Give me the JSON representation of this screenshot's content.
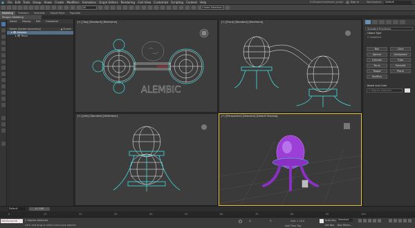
{
  "menus": [
    "File",
    "Edit",
    "Tools",
    "Group",
    "Views",
    "Create",
    "Modifiers",
    "Animation",
    "Graph Editors",
    "Rendering",
    "Civil View",
    "Customize",
    "Scripting",
    "Content",
    "Help"
  ],
  "title_right": {
    "file": "D:\\Stephens\\alembic_project_alembic.max",
    "signin": "Sign In",
    "workspace": "Default"
  },
  "toolbar": {
    "filter_value": "All",
    "selection_set": "Create Selection Se"
  },
  "ribbon_tabs": [
    "Modeling",
    "Freeform",
    "Selection",
    "Object Paint",
    "Populate"
  ],
  "ribbon_active": "Polygon Modeling",
  "explorer": {
    "tabs": [
      "Select",
      "Display",
      "Edit",
      "Customize"
    ],
    "column_header": "Name (Sorted Ascending)",
    "column_right": "▲ Frozen",
    "rows": [
      "Alembic",
      "Tesus"
    ]
  },
  "viewports": {
    "top": "[+] [Top] [Standard] [Wireframe]",
    "front": "[+] [Front] [Standard] [Wireframe]",
    "left": "[+] [Left] [Standard] [Wireframe]",
    "perspective": "[+] [Perspective] [Standard] [Default Shading]",
    "watermark": "ALEMBIC"
  },
  "command_panel": {
    "dropdown": "Standard Primitives",
    "section_object_type": "Object Type",
    "autogrid": "AutoGrid",
    "buttons": [
      "Box",
      "Cone",
      "Sphere",
      "GeoSphere",
      "Cylinder",
      "Tube",
      "Torus",
      "Pyramid",
      "Teapot",
      "Plane",
      "TextPlus"
    ],
    "section_name": "Name and Color",
    "name_value": "2 Objects Selected"
  },
  "layer": "Default",
  "time": {
    "frame": "0 / 100",
    "ticks": [
      "0",
      "10",
      "20",
      "30",
      "40",
      "50",
      "60",
      "70",
      "80",
      "90",
      "100"
    ]
  },
  "status": {
    "selected": "2 Objects Selected",
    "hint": "Click and drag to select and move objects",
    "script": "MAXScript Mi",
    "grid": "Grid = 10.0",
    "add_time_tag": "Add Time Tag",
    "autokey": "Auto Key",
    "selected_label": "Selected",
    "setkey": "Set Key",
    "key_filters": "Key Filters..."
  },
  "colors": {
    "active_border": "#e2c33a",
    "wire": "#ffffff",
    "sel_wire": "#3fe0e0",
    "purple": "#9b3fd6",
    "selection": "#566f8a"
  }
}
